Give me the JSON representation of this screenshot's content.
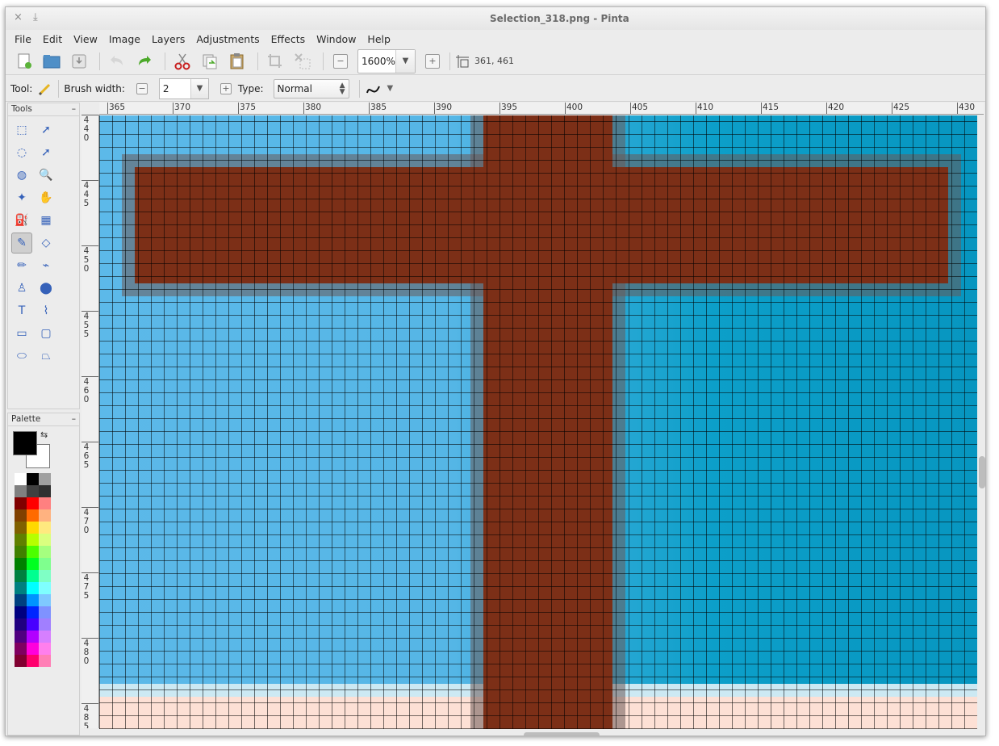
{
  "window": {
    "title": "Selection_318.png - Pinta",
    "close_glyph": "×",
    "pin_glyph": "⤓"
  },
  "menu": [
    "File",
    "Edit",
    "View",
    "Image",
    "Layers",
    "Adjustments",
    "Effects",
    "Window",
    "Help"
  ],
  "toolbar": {
    "zoom_value": "1600%",
    "cursor_position": "361, 461",
    "icons": [
      "new-file-icon",
      "open-folder-icon",
      "save-icon",
      "undo-icon",
      "redo-icon",
      "cut-icon",
      "copy-icon",
      "paste-icon",
      "crop-icon",
      "deselect-icon",
      "zoom-out-icon",
      "zoom-in-icon",
      "cursor-position-icon"
    ]
  },
  "tool_options": {
    "tool_label": "Tool:",
    "brush_width_label": "Brush width:",
    "brush_width_value": "2",
    "type_label": "Type:",
    "type_value": "Normal",
    "minus_glyph": "−",
    "plus_glyph": "+"
  },
  "panels": {
    "tools_title": "Tools",
    "palette_title": "Palette",
    "collapse_glyph": "–"
  },
  "tools": [
    {
      "name": "rectangle-select-icon",
      "glyph": "⬚"
    },
    {
      "name": "move-selected-icon",
      "glyph": "➚"
    },
    {
      "name": "lasso-select-icon",
      "glyph": "◌"
    },
    {
      "name": "move-selection-icon",
      "glyph": "➚"
    },
    {
      "name": "ellipse-select-icon",
      "glyph": "◍"
    },
    {
      "name": "zoom-icon",
      "glyph": "🔍"
    },
    {
      "name": "magic-wand-icon",
      "glyph": "✦"
    },
    {
      "name": "pan-icon",
      "glyph": "✋"
    },
    {
      "name": "paint-bucket-icon",
      "glyph": "⛽"
    },
    {
      "name": "gradient-icon",
      "glyph": "▦"
    },
    {
      "name": "paintbrush-icon",
      "glyph": "✎",
      "active": true
    },
    {
      "name": "eraser-icon",
      "glyph": "◇"
    },
    {
      "name": "pencil-icon",
      "glyph": "✏"
    },
    {
      "name": "color-picker-icon",
      "glyph": "⌁"
    },
    {
      "name": "clone-stamp-icon",
      "glyph": "♙"
    },
    {
      "name": "recolor-icon",
      "glyph": "⬤"
    },
    {
      "name": "text-icon",
      "glyph": "T"
    },
    {
      "name": "line-curve-icon",
      "glyph": "⌇"
    },
    {
      "name": "rectangle-icon",
      "glyph": "▭"
    },
    {
      "name": "rounded-rectangle-icon",
      "glyph": "▢"
    },
    {
      "name": "ellipse-icon",
      "glyph": "⬭"
    },
    {
      "name": "freeform-shape-icon",
      "glyph": "⏢"
    }
  ],
  "palette": {
    "primary": "#000000",
    "secondary": "#ffffff",
    "swatches": [
      "#ffffff",
      "#000000",
      "#a0a0a0",
      "#808080",
      "#404040",
      "#303030",
      "#800000",
      "#ff0000",
      "#ff8080",
      "#804000",
      "#ff6a00",
      "#ffb280",
      "#806000",
      "#ffd800",
      "#ffe97f",
      "#608000",
      "#b6ff00",
      "#daff7f",
      "#408000",
      "#4cff00",
      "#a5ff7f",
      "#008000",
      "#00ff21",
      "#7fff8e",
      "#008040",
      "#00ff90",
      "#7fffc5",
      "#008080",
      "#00ffff",
      "#7fffff",
      "#004080",
      "#0094ff",
      "#7fc9ff",
      "#000080",
      "#0026ff",
      "#7f92ff",
      "#200080",
      "#4800ff",
      "#a17fff",
      "#500080",
      "#b200ff",
      "#d67fff",
      "#800060",
      "#ff00dc",
      "#ff7fed",
      "#800030",
      "#ff006e",
      "#ff7fb6"
    ]
  },
  "rulers": {
    "horizontal": [
      "365",
      "370",
      "375",
      "380",
      "385",
      "390",
      "395",
      "400",
      "405",
      "410",
      "415",
      "420",
      "425",
      "430"
    ],
    "vertical": [
      [
        "4",
        "4",
        "0"
      ],
      [
        "4",
        "4",
        "5"
      ],
      [
        "4",
        "5",
        "0"
      ],
      [
        "4",
        "5",
        "5"
      ],
      [
        "4",
        "6",
        "0"
      ],
      [
        "4",
        "6",
        "5"
      ],
      [
        "4",
        "7",
        "0"
      ],
      [
        "4",
        "7",
        "5"
      ],
      [
        "4",
        "8",
        "0"
      ],
      [
        "4",
        "8",
        "5"
      ]
    ]
  }
}
